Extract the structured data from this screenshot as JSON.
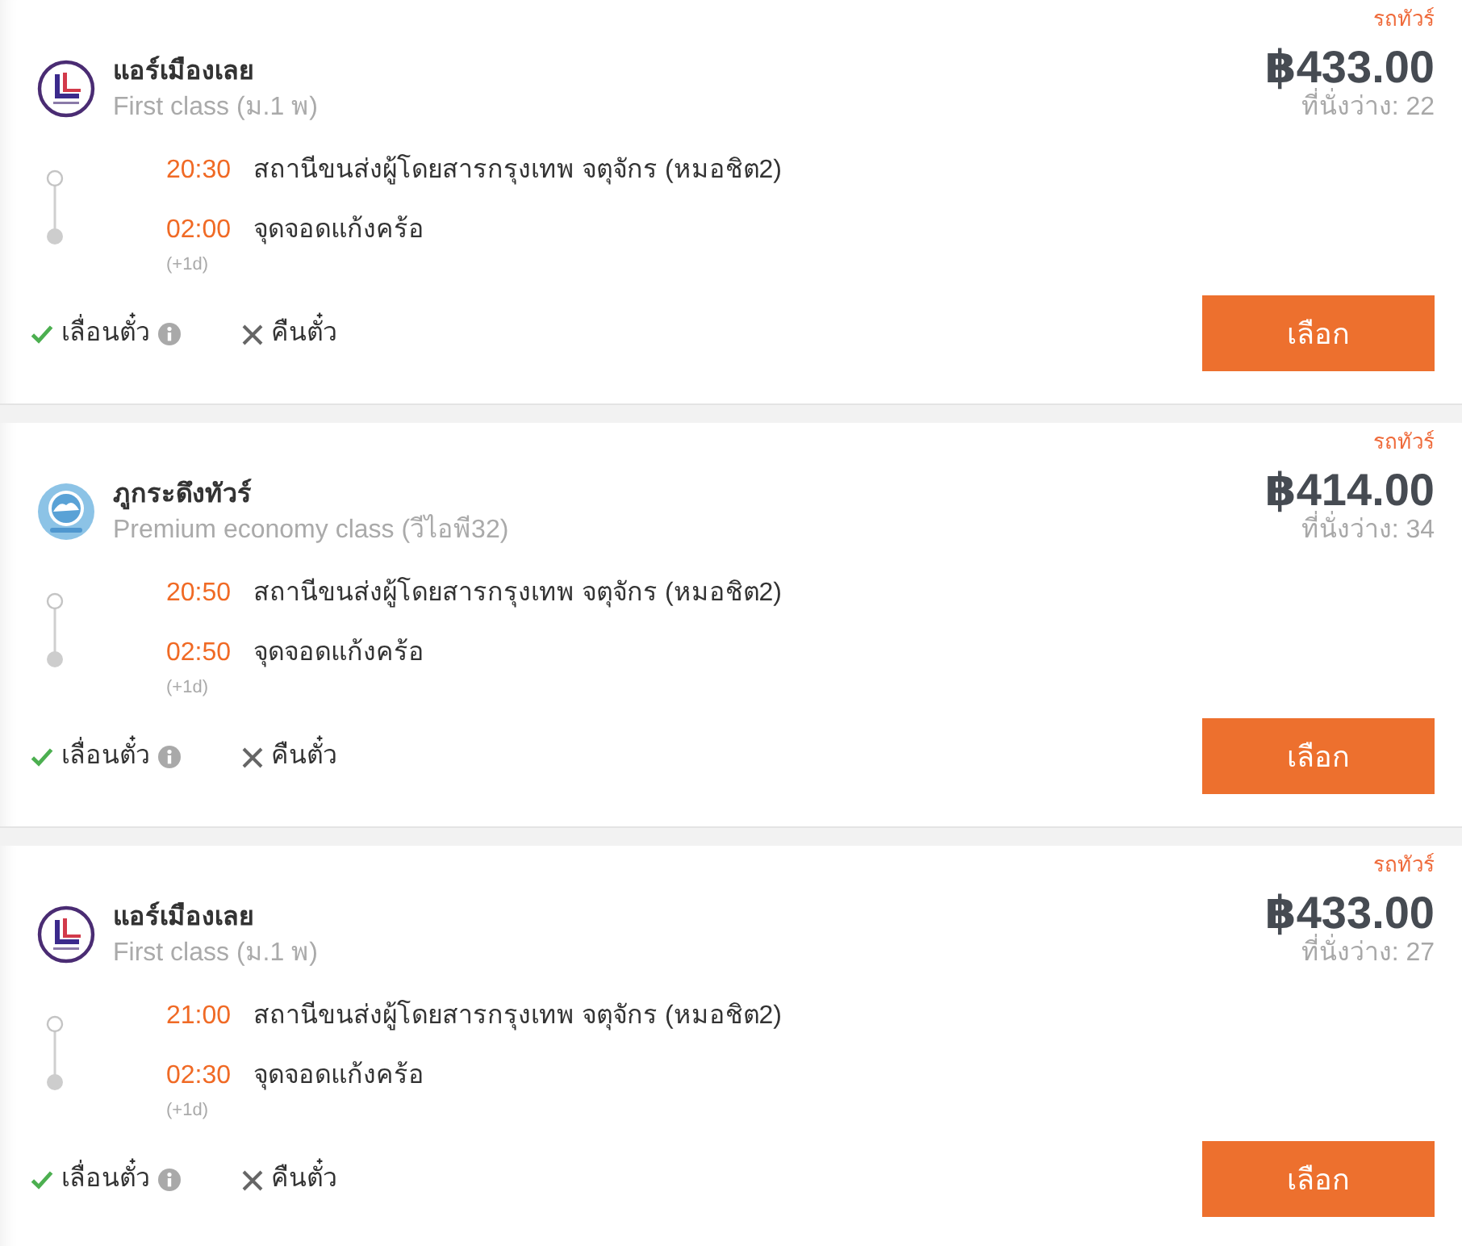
{
  "trips": [
    {
      "tag": "รถทัวร์",
      "operator": "แอร์เมืองเลย",
      "logo": {
        "kind": "ring"
      },
      "seat_class": "First class (ม.1 พ)",
      "price": "฿433.00",
      "seats": "ที่นั่งว่าง: 22",
      "departure": {
        "time": "20:30",
        "place": "สถานีขนส่งผู้โดยสารกรุงเทพ จตุจักร (หมอชิต2)"
      },
      "arrival": {
        "time": "02:00",
        "place": "จุดจอดแก้งคร้อ",
        "day_offset": "(+1d)"
      },
      "policies": [
        {
          "label": "เลื่อนตั๋ว",
          "allowed": true,
          "info": true
        },
        {
          "label": "คืนตั๋ว",
          "allowed": false,
          "info": false
        }
      ],
      "button": "เลือก"
    },
    {
      "tag": "รถทัวร์",
      "operator": "ภูกระดึงทัวร์",
      "logo": {
        "kind": "disc"
      },
      "seat_class": "Premium economy class (วีไอพี32)",
      "price": "฿414.00",
      "seats": "ที่นั่งว่าง: 34",
      "departure": {
        "time": "20:50",
        "place": "สถานีขนส่งผู้โดยสารกรุงเทพ จตุจักร (หมอชิต2)"
      },
      "arrival": {
        "time": "02:50",
        "place": "จุดจอดแก้งคร้อ",
        "day_offset": "(+1d)"
      },
      "policies": [
        {
          "label": "เลื่อนตั๋ว",
          "allowed": true,
          "info": true
        },
        {
          "label": "คืนตั๋ว",
          "allowed": false,
          "info": false
        }
      ],
      "button": "เลือก"
    },
    {
      "tag": "รถทัวร์",
      "operator": "แอร์เมืองเลย",
      "logo": {
        "kind": "ring"
      },
      "seat_class": "First class (ม.1 พ)",
      "price": "฿433.00",
      "seats": "ที่นั่งว่าง: 27",
      "departure": {
        "time": "21:00",
        "place": "สถานีขนส่งผู้โดยสารกรุงเทพ จตุจักร (หมอชิต2)"
      },
      "arrival": {
        "time": "02:30",
        "place": "จุดจอดแก้งคร้อ",
        "day_offset": "(+1d)"
      },
      "policies": [
        {
          "label": "เลื่อนตั๋ว",
          "allowed": true,
          "info": true
        },
        {
          "label": "คืนตั๋ว",
          "allowed": false,
          "info": false
        }
      ],
      "button": "เลือก"
    }
  ]
}
